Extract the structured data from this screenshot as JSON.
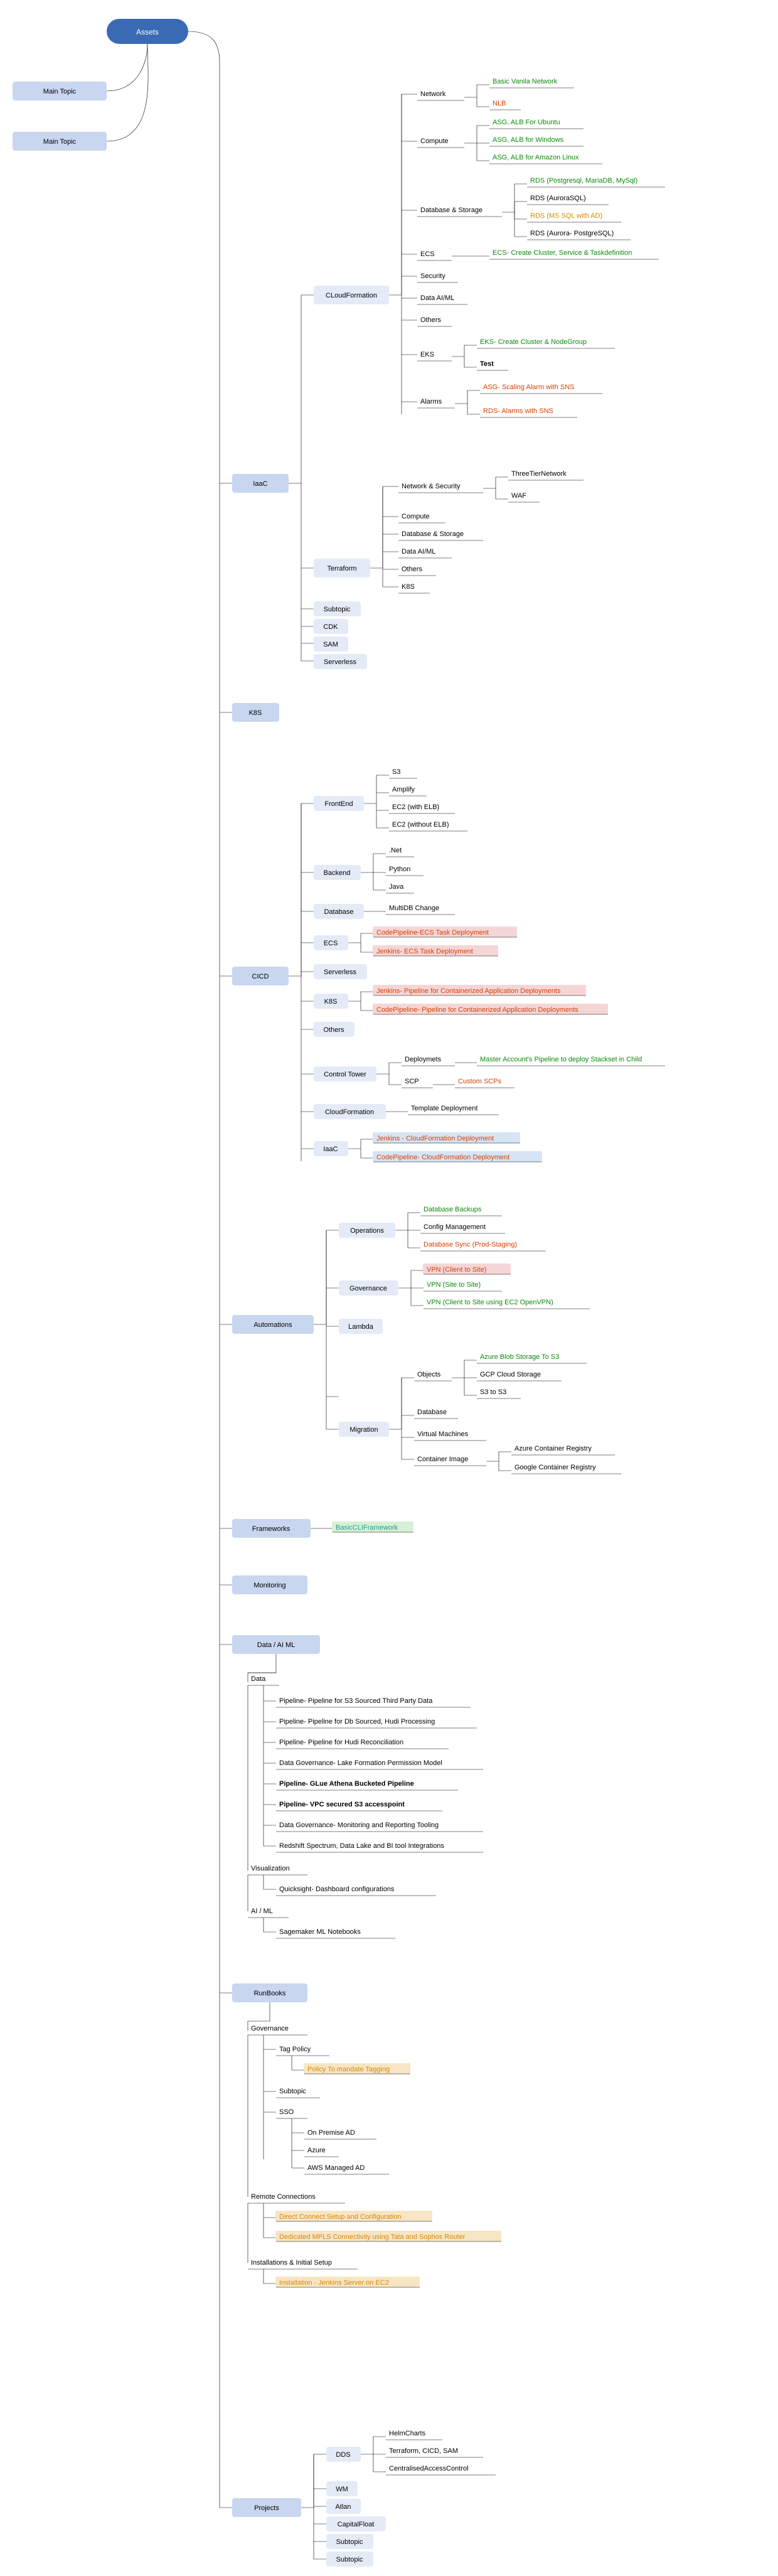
{
  "root": "Assets",
  "side1": "Main Topic",
  "side2": "Main Topic",
  "iaac": {
    "label": "IaaC",
    "cloudformation": {
      "label": "CLoudFormation",
      "network": {
        "label": "Network",
        "items": [
          "Basic Vanila Network",
          "NLB"
        ],
        "colors": [
          "green",
          "red"
        ]
      },
      "compute": {
        "label": "Compute",
        "items": [
          "ASG, ALB For Ubuntu",
          "ASG, ALB for Windows",
          "ASG, ALB for Amazon Linux"
        ],
        "colors": [
          "green",
          "green",
          "green"
        ]
      },
      "db": {
        "label": "Database & Storage",
        "items": [
          "RDS (Postgresql, MariaDB, MySql)",
          "RDS (AuroraSQL)",
          "RDS (MS SQL with AD)",
          "RDS (Aurora- PostgreSQL)"
        ],
        "colors": [
          "green",
          "black",
          "orange",
          "black"
        ]
      },
      "ecs": {
        "label": "ECS",
        "items": [
          "ECS- Create Cluster, Service & Taskdefinition"
        ],
        "colors": [
          "green"
        ]
      },
      "security": {
        "label": "Security"
      },
      "dataai": {
        "label": "Data AI/ML"
      },
      "others": {
        "label": "Others"
      },
      "eks": {
        "label": "EKS",
        "items": [
          "EKS- Create Cluster & NodeGroup",
          "Test"
        ],
        "colors": [
          "green",
          "bold"
        ]
      },
      "alarms": {
        "label": "Alarms",
        "items": [
          "ASG- Scaling Alarm with SNS",
          "RDS- Alarms with SNS"
        ],
        "colors": [
          "red",
          "red"
        ]
      }
    },
    "terraform": {
      "label": "Terraform",
      "netsec": {
        "label": "Network & Security",
        "items": [
          "ThreeTierNetwork",
          "WAF"
        ],
        "colors": [
          "black",
          "black"
        ]
      },
      "compute": {
        "label": "Compute"
      },
      "db": {
        "label": "Database & Storage"
      },
      "dataai": {
        "label": "Data AI/ML"
      },
      "others": {
        "label": "Others"
      },
      "k8s": {
        "label": "K8S"
      }
    },
    "subtopic": {
      "label": "Subtopic"
    },
    "cdk": {
      "label": "CDK"
    },
    "sam": {
      "label": "SAM"
    },
    "serverless": {
      "label": "Serverless"
    }
  },
  "k8s_top": {
    "label": "K8S"
  },
  "cicd": {
    "label": "CICD",
    "frontend": {
      "label": "FrontEnd",
      "items": [
        "S3",
        "Amplify",
        "EC2 (with ELB)",
        "EC2 (without ELB)"
      ]
    },
    "backend": {
      "label": "Backend",
      "items": [
        ".Net",
        "Python",
        "Java"
      ]
    },
    "database": {
      "label": "Database",
      "items": [
        "MultiDB Change"
      ]
    },
    "ecs": {
      "label": "ECS",
      "items": [
        "CodePipeline-ECS Task Deployment",
        "Jenkins- ECS Task Deployment"
      ],
      "colors": [
        "red",
        "red"
      ],
      "hl": [
        "pink",
        "pink"
      ]
    },
    "serverless": {
      "label": "Serverless"
    },
    "k8s": {
      "label": "K8S",
      "items": [
        "Jenkins- Pipeline for Containerized Application Deployments",
        "CodePipeline- Pipeline for Containerized Application Deployments"
      ],
      "colors": [
        "red",
        "red"
      ],
      "hl": [
        "pink",
        "pink"
      ]
    },
    "others": {
      "label": "Others"
    },
    "controltower": {
      "label": "Control Tower",
      "deploy": {
        "label": "Deploymets",
        "items": [
          "Master Account's Pipeline to deploy Stackset in Child"
        ],
        "colors": [
          "green"
        ]
      },
      "scp": {
        "label": "SCP",
        "items": [
          "Custom SCPs"
        ],
        "colors": [
          "red"
        ]
      }
    },
    "cloudformation": {
      "label": "CloudFormation",
      "items": [
        "Template Deployment"
      ]
    },
    "iaac": {
      "label": "IaaC",
      "items": [
        "Jenkins - CloudFormation Deployment",
        "CodePipeline- CloudFormation Deployment"
      ],
      "colors": [
        "red",
        "red"
      ],
      "hl": [
        "blue",
        "blue"
      ]
    }
  },
  "automations": {
    "label": "Automations",
    "operations": {
      "label": "Operations",
      "items": [
        "Database Backups",
        "Config Management",
        "Database Sync (Prod-Staging)"
      ],
      "colors": [
        "green",
        "black",
        "red"
      ]
    },
    "governance": {
      "label": "Governance",
      "items": [
        "VPN (Client to Site)",
        "VPN (Site to Site)",
        "VPN (Client to Site using EC2 OpenVPN)"
      ],
      "colors": [
        "red",
        "green",
        "green"
      ],
      "hl": [
        "pink",
        "",
        ""
      ]
    },
    "lambda": {
      "label": "Lambda"
    },
    "migration": {
      "label": "Migration",
      "objects": {
        "label": "Objects",
        "items": [
          "Azure Blob  Storage To S3",
          "GCP Cloud Storage",
          "S3 to S3"
        ],
        "colors": [
          "green",
          "black",
          "black"
        ]
      },
      "database": {
        "label": "Database"
      },
      "vm": {
        "label": "Virtual Machines"
      },
      "container": {
        "label": "Container Image",
        "items": [
          "Azure Container Registry",
          "Google Container Registry"
        ]
      }
    }
  },
  "frameworks": {
    "label": "Frameworks",
    "items": [
      "BasicCLIFramework"
    ],
    "colors": [
      "teal"
    ],
    "hl": [
      "green"
    ]
  },
  "monitoring": {
    "label": "Monitoring"
  },
  "dataai": {
    "label": "Data / AI ML",
    "data": {
      "label": "Data",
      "items": [
        "Pipeline- Pipeline for S3 Sourced Third Party Data",
        "Pipeline- Pipeline for Db Sourced, Hudi Processing",
        "Pipeline- Pipeline for Hudi Reconciliation",
        "Data Governance- Lake Formation Permission Model",
        "Pipeline- GLue Athena Bucketed Pipeline",
        "Pipeline- VPC secured S3 accesspoint",
        "Data Governance- Monitoring and Reporting Tooling",
        "Redshift Spectrum, Data Lake and BI tool Integrations"
      ]
    },
    "viz": {
      "label": "Visualization",
      "items": [
        "Quicksight- Dashboard configurations"
      ]
    },
    "aiml": {
      "label": "AI / ML",
      "items": [
        "Sagemaker ML Notebooks"
      ]
    }
  },
  "runbooks": {
    "label": "RunBooks",
    "governance": {
      "label": "Governance",
      "tagpolicy": {
        "label": "Tag Policy",
        "items": [
          "Policy To mandate Tagging"
        ],
        "colors": [
          "orange"
        ],
        "hl": [
          "orange"
        ]
      },
      "subtopic": {
        "label": "Subtopic"
      },
      "sso": {
        "label": "SSO",
        "items": [
          "On Premise AD",
          "Azure",
          "AWS Managed AD"
        ]
      }
    },
    "remote": {
      "label": "Remote Connections",
      "items": [
        "Direct Connect Setup and Configuration",
        "Dedicated MPLS Connectivity using Tata and Sophos Router"
      ],
      "colors": [
        "orange",
        "orange"
      ],
      "hl": [
        "orange",
        "orange"
      ]
    },
    "install": {
      "label": "Installations & Initial Setup",
      "items": [
        "Installation - Jenkins Server on EC2"
      ],
      "colors": [
        "orange"
      ],
      "hl": [
        "orange"
      ]
    }
  },
  "projects": {
    "label": "Projects",
    "dds": {
      "label": "DDS",
      "items": [
        "HelmCharts",
        "Terraform, CICD, SAM",
        "CentralisedAccessControl"
      ]
    },
    "wm": {
      "label": "WM"
    },
    "atlan": {
      "label": "Atlan"
    },
    "cf": {
      "label": "CapitalFloat"
    },
    "s1": {
      "label": "Subtopic"
    },
    "s2": {
      "label": "Subtopic"
    }
  }
}
